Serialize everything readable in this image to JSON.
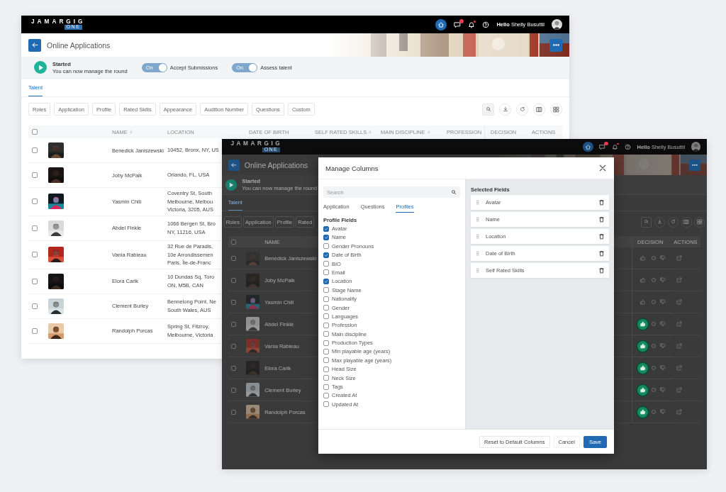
{
  "background_app": {
    "top_bar": {
      "logo": "JAMARGIG",
      "logo_badge": "ONE",
      "greeting": "**Hello** Shelly Busuttil"
    },
    "header": {
      "title": "Online Applications"
    },
    "status": {
      "title": "Started",
      "subtitle": "You can now manage the round",
      "toggles": [
        {
          "state_label": "On",
          "label": "Accept Submissions",
          "on": true
        },
        {
          "state_label": "On",
          "label": "Assess talent",
          "on": true
        }
      ]
    },
    "tabs": [
      {
        "label": "Talent",
        "selected": true
      }
    ],
    "filters": [
      "Roles",
      "Application",
      "Profile",
      "Rated Skills",
      "Appearance",
      "Audition Number",
      "Questions",
      "Custom"
    ],
    "table": {
      "all_checked": false,
      "columns": [
        {
          "kind": "name",
          "label": "NAME",
          "sortable": true
        },
        {
          "kind": "location",
          "label": "LOCATION",
          "sortable": false
        },
        {
          "kind": "date_of_birth",
          "label": "DATE OF BIRTH",
          "sortable": false
        },
        {
          "kind": "self_rated_skills",
          "label": "SELF RATED SKILLS",
          "sortable": true
        },
        {
          "kind": "main_discipline",
          "label": "MAIN DISCIPLINE",
          "sortable": true
        },
        {
          "kind": "profession",
          "label": "PROFESSION",
          "sortable": false
        },
        {
          "kind": "decision",
          "label": "DECISION",
          "sortable": false
        },
        {
          "kind": "actions",
          "label": "ACTIONS",
          "sortable": false
        }
      ],
      "rows": [
        {
          "checked": false,
          "name": "Benedick Janiszewski",
          "location": [
            "10452, Bronx, NY, US"
          ]
        },
        {
          "checked": false,
          "name": "Joby McPaik",
          "location": [
            "Orlando, FL, USA"
          ]
        },
        {
          "checked": false,
          "name": "Yasmin Chili",
          "location": [
            "Coventry St, South",
            "Melbourne, Melbou",
            "Victoria, 3205, AUS"
          ]
        },
        {
          "checked": false,
          "name": "Abdel Finkle",
          "location": [
            "1066 Bergen St, Bro",
            "NY, 11216, USA"
          ]
        },
        {
          "checked": false,
          "name": "Vania Rabieau",
          "location": [
            "32 Rue de Paradis,",
            "10e Arrondissemen",
            "Paris, Île-de-Franc"
          ]
        },
        {
          "checked": false,
          "name": "Elora Carik",
          "location": [
            "10 Dundas Sq, Toro",
            "ON, M5B, CAN"
          ]
        },
        {
          "checked": false,
          "name": "Clement Burley",
          "location": [
            "Bennelong Point, Ne",
            "South Wales, AUS"
          ]
        },
        {
          "checked": false,
          "name": "Randolph Porcas",
          "location": [
            "Spring St, Fitzroy,",
            "Melbourne, Victoria"
          ]
        }
      ]
    }
  },
  "foreground_app": {
    "top_bar": {
      "logo": "JAMARGIG",
      "logo_badge": "ONE",
      "greeting": "**Hello** Shelly Busuttil"
    },
    "header": {
      "title": "Online Applications"
    },
    "status": {
      "title": "Started",
      "subtitle": "You can now manage the round"
    },
    "tabs": [
      {
        "label": "Talent",
        "selected": true
      }
    ],
    "filters": [
      "Roles",
      "Application",
      "Profile",
      "Rated"
    ],
    "table": {
      "all_checked": false,
      "columns": [
        {
          "kind": "name",
          "label": "NAME"
        },
        {
          "kind": "decision",
          "label": "DECISION"
        },
        {
          "kind": "actions",
          "label": "ACTIONS"
        }
      ],
      "rows": [
        {
          "checked": false,
          "name": "Benedick Janiszewski",
          "approved": false
        },
        {
          "checked": false,
          "name": "Joby McPaik",
          "approved": false
        },
        {
          "checked": false,
          "name": "Yasmin Chili",
          "approved": false
        },
        {
          "checked": false,
          "name": "Abdel Finkle",
          "approved": true
        },
        {
          "checked": false,
          "name": "Vania Rabieau",
          "approved": true
        },
        {
          "checked": false,
          "name": "Elora Carik",
          "approved": true
        },
        {
          "checked": false,
          "name": "Clement Burley",
          "approved": true
        },
        {
          "checked": false,
          "name": "Randolph Porcas",
          "approved": true
        }
      ]
    }
  },
  "modal": {
    "title": "Manage Columns",
    "search": {
      "placeholder": "Search"
    },
    "tabs": [
      {
        "label": "Application",
        "selected": false
      },
      {
        "label": "Questions",
        "selected": false
      },
      {
        "label": "Profiles",
        "selected": true
      }
    ],
    "fields_heading": "Profile Fields",
    "fields": [
      {
        "label": "Avatar",
        "checked": true
      },
      {
        "label": "Name",
        "checked": true
      },
      {
        "label": "Gender Pronouns",
        "checked": false
      },
      {
        "label": "Date of Birth",
        "checked": true
      },
      {
        "label": "BIO",
        "checked": false
      },
      {
        "label": "Email",
        "checked": false
      },
      {
        "label": "Location",
        "checked": true
      },
      {
        "label": "Stage Name",
        "checked": false
      },
      {
        "label": "Nationality",
        "checked": false
      },
      {
        "label": "Gender",
        "checked": false
      },
      {
        "label": "Languages",
        "checked": false
      },
      {
        "label": "Profession",
        "checked": false
      },
      {
        "label": "Main discipline",
        "checked": false
      },
      {
        "label": "Production Types",
        "checked": false
      },
      {
        "label": "Min playable age (years)",
        "checked": false
      },
      {
        "label": "Max playable age (years)",
        "checked": false
      },
      {
        "label": "Head Size",
        "checked": false
      },
      {
        "label": "Neck Size",
        "checked": false
      },
      {
        "label": "Tags",
        "checked": false
      },
      {
        "label": "Created At",
        "checked": false
      },
      {
        "label": "Updated At",
        "checked": false
      }
    ],
    "selected_heading": "Selected Fields",
    "selected_fields": [
      "Avatar",
      "Name",
      "Location",
      "Date of Birth",
      "Self Rated Skills"
    ],
    "buttons": [
      {
        "label": "Reset to Default Columns",
        "kind": "outline"
      },
      {
        "label": "Cancel",
        "kind": "text"
      },
      {
        "label": "Save",
        "kind": "primary"
      }
    ]
  }
}
